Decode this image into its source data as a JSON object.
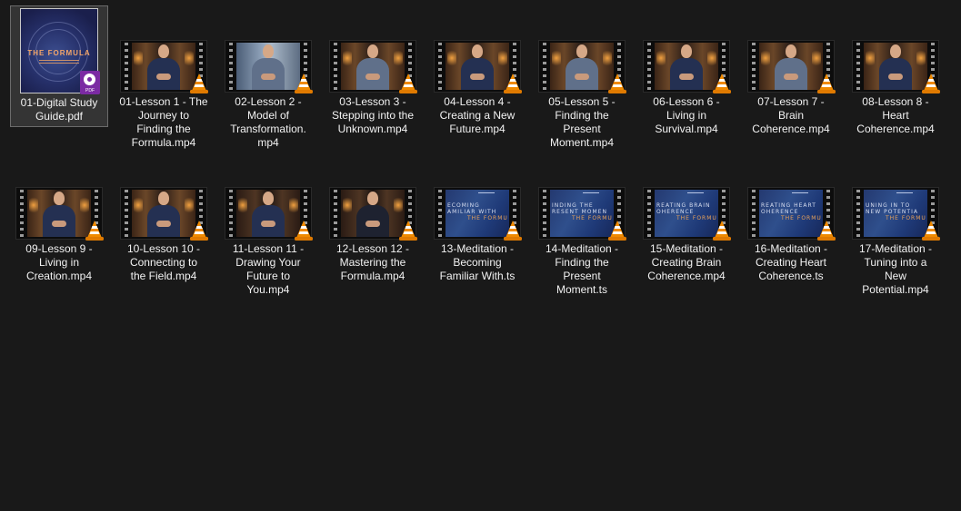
{
  "folder": {
    "items": [
      {
        "name": "01-Digital Study Guide.pdf",
        "lines": [
          "01-Digital Study",
          "Guide.pdf"
        ],
        "type": "pdf",
        "selected": true,
        "cover_title": "THE FORMULA",
        "badge": "PDF"
      },
      {
        "name": "01-Lesson 1 - The Journey to Finding the Formula.mp4",
        "lines": [
          "01-Lesson 1 - The",
          "Journey to",
          "Finding the",
          "Formula.mp4"
        ],
        "type": "lesson",
        "scene": "brown",
        "shirt": "navy"
      },
      {
        "name": "02-Lesson 2 - Model of Transformation.mp4",
        "lines": [
          "02-Lesson 2 -",
          "Model of",
          "Transformation.",
          "mp4"
        ],
        "type": "lesson",
        "scene": "blue",
        "shirt": "grey"
      },
      {
        "name": "03-Lesson 3 - Stepping into the Unknown.mp4",
        "lines": [
          "03-Lesson 3 -",
          "Stepping into the",
          "Unknown.mp4"
        ],
        "type": "lesson",
        "scene": "brown",
        "shirt": "grey"
      },
      {
        "name": "04-Lesson 4 - Creating a New Future.mp4",
        "lines": [
          "04-Lesson 4 -",
          "Creating a New",
          "Future.mp4"
        ],
        "type": "lesson",
        "scene": "brown",
        "shirt": "navy"
      },
      {
        "name": "05-Lesson 5 - Finding the Present Moment.mp4",
        "lines": [
          "05-Lesson 5 -",
          "Finding the",
          "Present",
          "Moment.mp4"
        ],
        "type": "lesson",
        "scene": "brown",
        "shirt": "grey"
      },
      {
        "name": "06-Lesson 6 - Living in Survival.mp4",
        "lines": [
          "06-Lesson 6 -",
          "Living in",
          "Survival.mp4"
        ],
        "type": "lesson",
        "scene": "brown",
        "shirt": "navy"
      },
      {
        "name": "07-Lesson 7 - Brain Coherence.mp4",
        "lines": [
          "07-Lesson 7 -",
          "Brain",
          "Coherence.mp4"
        ],
        "type": "lesson",
        "scene": "brown",
        "shirt": "grey"
      },
      {
        "name": "08-Lesson 8 - Heart Coherence.mp4",
        "lines": [
          "08-Lesson 8 -",
          "Heart",
          "Coherence.mp4"
        ],
        "type": "lesson",
        "scene": "brown",
        "shirt": "navy"
      },
      {
        "name": "09-Lesson 9 - Living in Creation.mp4",
        "lines": [
          "09-Lesson 9 -",
          "Living in",
          "Creation.mp4"
        ],
        "type": "lesson",
        "scene": "brown",
        "shirt": "navy"
      },
      {
        "name": "10-Lesson 10 - Connecting to the Field.mp4",
        "lines": [
          "10-Lesson 10 -",
          "Connecting to",
          "the Field.mp4"
        ],
        "type": "lesson",
        "scene": "brown",
        "shirt": "navy"
      },
      {
        "name": "11-Lesson 11 - Drawing Your Future to You.mp4",
        "lines": [
          "11-Lesson 11 -",
          "Drawing Your",
          "Future to",
          "You.mp4"
        ],
        "type": "lesson",
        "scene": "dark",
        "shirt": "navy"
      },
      {
        "name": "12-Lesson 12 - Mastering the Formula.mp4",
        "lines": [
          "12-Lesson 12 -",
          "Mastering the",
          "Formula.mp4"
        ],
        "type": "lesson",
        "scene": "dark",
        "shirt": "black"
      },
      {
        "name": "13-Meditation - Becoming Familiar With.ts",
        "lines": [
          "13-Meditation -",
          "Becoming",
          "Familiar With.ts"
        ],
        "type": "meditation",
        "thumb_text": [
          "ECOMING",
          "AMILIAR WITH"
        ]
      },
      {
        "name": "14-Meditation - Finding the Present Moment.ts",
        "lines": [
          "14-Meditation -",
          "Finding the",
          "Present",
          "Moment.ts"
        ],
        "type": "meditation",
        "thumb_text": [
          "INDING THE",
          "RESENT MOMEN"
        ]
      },
      {
        "name": "15-Meditation - Creating Brain Coherence.mp4",
        "lines": [
          "15-Meditation -",
          "Creating Brain",
          "Coherence.mp4"
        ],
        "type": "meditation",
        "thumb_text": [
          "REATING BRAIN",
          "OHERENCE"
        ]
      },
      {
        "name": "16-Meditation - Creating Heart Coherence.ts",
        "lines": [
          "16-Meditation -",
          "Creating Heart",
          "Coherence.ts"
        ],
        "type": "meditation",
        "thumb_text": [
          "REATING HEART",
          "OHERENCE"
        ]
      },
      {
        "name": "17-Meditation - Tuning into a New Potential.mp4",
        "lines": [
          "17-Meditation -",
          "Tuning into a",
          "New",
          "Potential.mp4"
        ],
        "type": "meditation",
        "thumb_text": [
          "UNING IN TO",
          "NEW POTENTIA"
        ]
      }
    ],
    "thumb_brand": "THE FORMULA",
    "colors": {
      "background": "#191919",
      "selection": "#343434",
      "vlc_orange": "#f08a00"
    }
  }
}
